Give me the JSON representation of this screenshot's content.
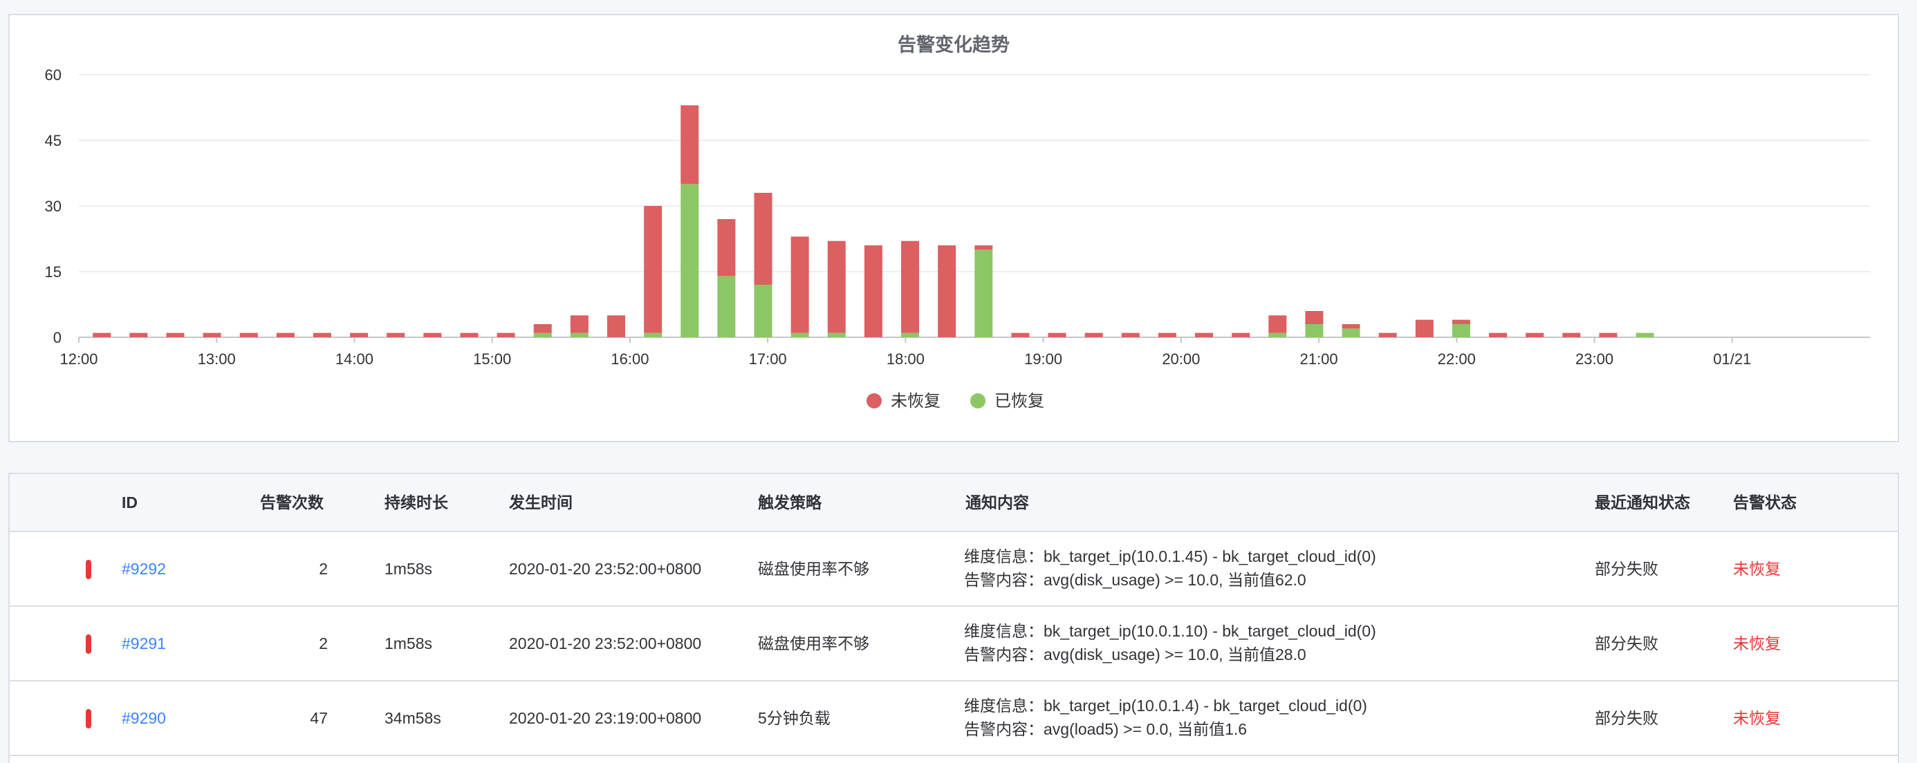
{
  "chart_data": {
    "type": "bar",
    "title": "告警变化趋势",
    "stacked": true,
    "ylim": [
      0,
      60
    ],
    "yticks": [
      0,
      15,
      30,
      45,
      60
    ],
    "x_tick_labels": [
      "12:00",
      "13:00",
      "14:00",
      "15:00",
      "16:00",
      "17:00",
      "18:00",
      "19:00",
      "20:00",
      "21:00",
      "22:00",
      "23:00",
      "01/21"
    ],
    "x_start": "12:00",
    "interval_minutes": 16,
    "legend_position": "bottom-center",
    "grid": true,
    "categories": [
      "12:10",
      "12:26",
      "12:42",
      "12:58",
      "13:14",
      "13:30",
      "13:46",
      "14:02",
      "14:18",
      "14:34",
      "14:50",
      "15:06",
      "15:22",
      "15:38",
      "15:54",
      "16:10",
      "16:26",
      "16:42",
      "16:58",
      "17:14",
      "17:30",
      "17:46",
      "18:02",
      "18:18",
      "18:34",
      "18:50",
      "19:06",
      "19:22",
      "19:38",
      "19:54",
      "20:10",
      "20:26",
      "20:42",
      "20:58",
      "21:14",
      "21:30",
      "21:46",
      "22:02",
      "22:18",
      "22:34",
      "22:50",
      "23:06",
      "23:22"
    ],
    "series": [
      {
        "name": "已恢复",
        "color": "#8cc765",
        "values": [
          0,
          0,
          0,
          0,
          0,
          0,
          0,
          0,
          0,
          0,
          0,
          0,
          1,
          1,
          0,
          1,
          35,
          14,
          12,
          1,
          1,
          0,
          1,
          0,
          20,
          0,
          0,
          0,
          0,
          0,
          0,
          0,
          1,
          3,
          2,
          0,
          0,
          3,
          0,
          0,
          0,
          0,
          1
        ]
      },
      {
        "name": "未恢复",
        "color": "#dc5f61",
        "values": [
          1,
          1,
          1,
          1,
          1,
          1,
          1,
          1,
          1,
          1,
          1,
          1,
          2,
          4,
          5,
          29,
          18,
          13,
          21,
          22,
          21,
          21,
          21,
          21,
          1,
          1,
          1,
          1,
          1,
          1,
          1,
          1,
          4,
          3,
          1,
          1,
          4,
          1,
          1,
          1,
          1,
          1,
          0
        ]
      }
    ]
  },
  "table": {
    "headers": {
      "id": "ID",
      "count": "告警次数",
      "duration": "持续时长",
      "time": "发生时间",
      "strategy": "触发策略",
      "content": "通知内容",
      "notice_status": "最近通知状态",
      "alarm_status": "告警状态"
    },
    "rows": [
      {
        "id": "#9292",
        "count": "2",
        "duration": "1m58s",
        "time": "2020-01-20 23:52:00+0800",
        "strategy": "磁盘使用率不够",
        "content_line1": "维度信息：bk_target_ip(10.0.1.45) - bk_target_cloud_id(0)",
        "content_line2": "告警内容：avg(disk_usage) >= 10.0, 当前值62.0",
        "notice_status": "部分失败",
        "alarm_status": "未恢复"
      },
      {
        "id": "#9291",
        "count": "2",
        "duration": "1m58s",
        "time": "2020-01-20 23:52:00+0800",
        "strategy": "磁盘使用率不够",
        "content_line1": "维度信息：bk_target_ip(10.0.1.10) - bk_target_cloud_id(0)",
        "content_line2": "告警内容：avg(disk_usage) >= 10.0, 当前值28.0",
        "notice_status": "部分失败",
        "alarm_status": "未恢复"
      },
      {
        "id": "#9290",
        "count": "47",
        "duration": "34m58s",
        "time": "2020-01-20 23:19:00+0800",
        "strategy": "5分钟负载",
        "content_line1": "维度信息：bk_target_ip(10.0.1.4) - bk_target_cloud_id(0)",
        "content_line2": "告警内容：avg(load5) >= 0.0, 当前值1.6",
        "notice_status": "部分失败",
        "alarm_status": "未恢复"
      }
    ]
  },
  "colors": {
    "link": "#3a84ff",
    "danger": "#ea3636"
  }
}
